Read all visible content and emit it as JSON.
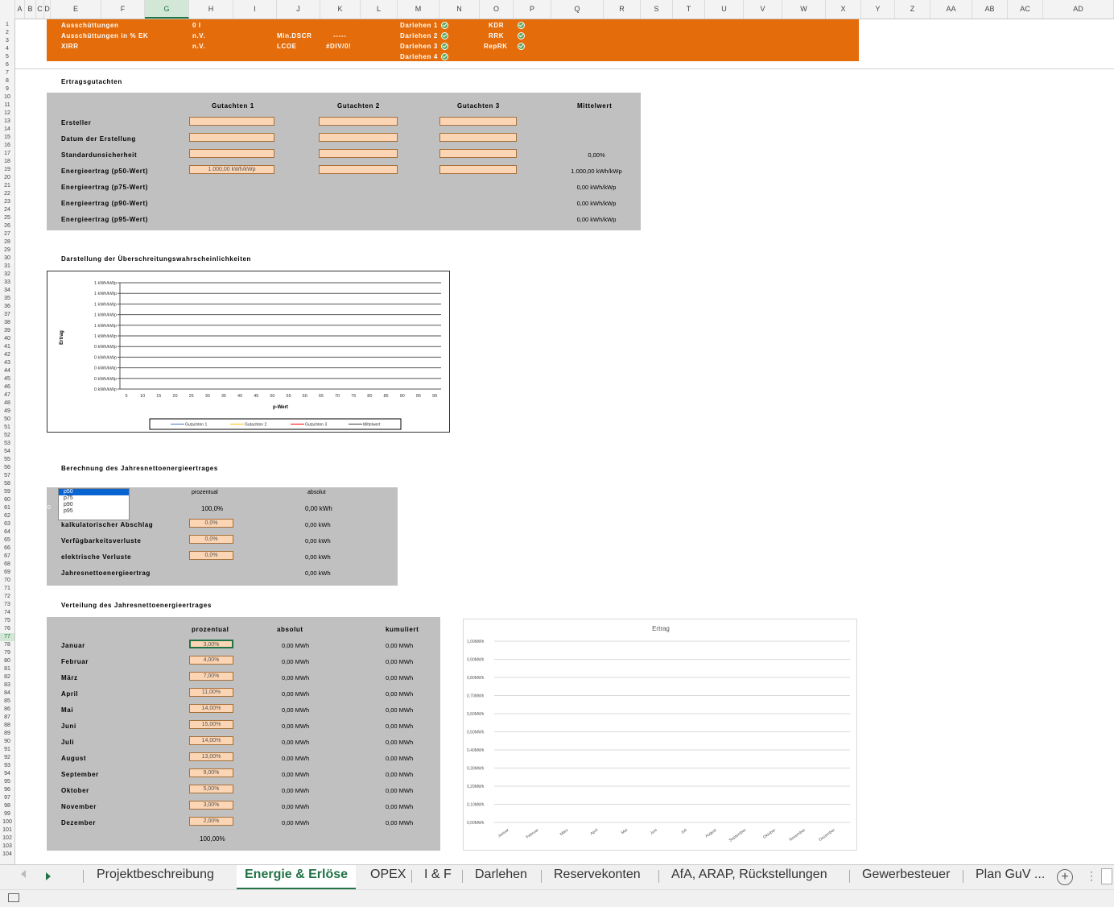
{
  "columns": [
    "A",
    "B",
    "C",
    "D",
    "E",
    "F",
    "G",
    "H",
    "I",
    "J",
    "K",
    "L",
    "M",
    "N",
    "O",
    "P",
    "Q",
    "R",
    "S",
    "T",
    "U",
    "V",
    "W",
    "X",
    "Y",
    "Z",
    "AA",
    "AB",
    "AC",
    "AD"
  ],
  "selected_column": "G",
  "selected_row": "77",
  "rows": [
    "1",
    "2",
    "3",
    "4",
    "5",
    "6",
    "7",
    "8",
    "9",
    "10",
    "11",
    "12",
    "13",
    "14",
    "15",
    "16",
    "17",
    "18",
    "19",
    "20",
    "21",
    "22",
    "23",
    "24",
    "25",
    "26",
    "27",
    "28",
    "29",
    "30",
    "31",
    "32",
    "33",
    "34",
    "35",
    "36",
    "37",
    "38",
    "39",
    "40",
    "41",
    "42",
    "43",
    "44",
    "45",
    "46",
    "47",
    "48",
    "49",
    "50",
    "51",
    "52",
    "53",
    "54",
    "55",
    "56",
    "57",
    "58",
    "59",
    "60",
    "61",
    "62",
    "63",
    "64",
    "65",
    "66",
    "67",
    "68",
    "69",
    "70",
    "71",
    "72",
    "73",
    "74",
    "75",
    "76",
    "77",
    "78",
    "79",
    "80",
    "81",
    "82",
    "83",
    "84",
    "85",
    "86",
    "87",
    "88",
    "89",
    "90",
    "91",
    "92",
    "93",
    "94",
    "95",
    "96",
    "97",
    "98",
    "99",
    "100",
    "101",
    "102",
    "103",
    "104"
  ],
  "summary": {
    "ausschuettungen_label": "Ausschüttungen",
    "ausschuettungen_value": "0 I",
    "ausschuettungen_ek_label": "Ausschüttungen in % EK",
    "ausschuettungen_ek_value": "n.V.",
    "xirr_label": "XIRR",
    "xirr_value": "n.V.",
    "min_dscr_label": "Min.DSCR",
    "min_dscr_value": "-----",
    "lcoe_label": "LCOE",
    "lcoe_value": "#DIV/0!",
    "darlehen": [
      "Darlehen 1",
      "Darlehen 2",
      "Darlehen 3",
      "Darlehen 4"
    ],
    "flags": [
      "KDR",
      "RRK",
      "RepRK"
    ]
  },
  "ertragsgutachten": {
    "title": "Ertragsgutachten",
    "headers": [
      "Gutachten 1",
      "Gutachten 2",
      "Gutachten 3",
      "Mittelwert"
    ],
    "rows": [
      {
        "label": "Ersteller",
        "g1": "",
        "mean": ""
      },
      {
        "label": "Datum der Erstellung",
        "g1": "",
        "mean": ""
      },
      {
        "label": "Standardunsicherheit",
        "g1": "",
        "mean": "0,00%"
      },
      {
        "label": "Energieertrag (p50-Wert)",
        "g1": "1.000,00 kWh/kWp",
        "mean": "1.000,00 kWh/kWp"
      },
      {
        "label": "Energieertrag (p75-Wert)",
        "g1": "",
        "mean": "0,00 kWh/kWp"
      },
      {
        "label": "Energieertrag (p90-Wert)",
        "g1": "",
        "mean": "0,00 kWh/kWp"
      },
      {
        "label": "Energieertrag (p95-Wert)",
        "g1": "",
        "mean": "0,00 kWh/kWp"
      }
    ]
  },
  "chart1": {
    "title": "Darstellung der Überschreitungswahrscheinlichkeiten",
    "ylabel": "Ertrag",
    "xlabel": "p-Wert",
    "ytick_labels": [
      "1 kWh/kWp",
      "1 kWh/kWp",
      "1 kWh/kWp",
      "1 kWh/kWp",
      "1 kWh/kWp",
      "1 kWh/kWp",
      "0 kWh/kWp",
      "0 kWh/kWp",
      "0 kWh/kWp",
      "0 kWh/kWp",
      "0 kWh/kWp"
    ],
    "legend": [
      "Gutachten 1",
      "Gutachten 2",
      "Gutachten 3",
      "Mittelwert"
    ],
    "legend_colors": [
      "#4472c4",
      "#ffc000",
      "#ff0000",
      "#404040"
    ]
  },
  "chart_data": [
    {
      "type": "line",
      "title": "",
      "xlabel": "p-Wert",
      "ylabel": "Ertrag",
      "x": [
        5,
        10,
        15,
        20,
        25,
        30,
        35,
        40,
        45,
        50,
        55,
        60,
        65,
        70,
        75,
        80,
        85,
        90,
        95,
        99
      ],
      "ylim": [
        0,
        1
      ],
      "series": [
        {
          "name": "Gutachten 1",
          "values": []
        },
        {
          "name": "Gutachten 2",
          "values": []
        },
        {
          "name": "Gutachten 3",
          "values": []
        },
        {
          "name": "Mittelwert",
          "values": []
        }
      ],
      "legend": "bottom",
      "grid": true
    },
    {
      "type": "bar",
      "title": "Ertrag",
      "categories": [
        "Januar",
        "Februar",
        "März",
        "April",
        "Mai",
        "Juni",
        "Juli",
        "August",
        "September",
        "Oktober",
        "November",
        "Dezember"
      ],
      "values": [
        0,
        0,
        0,
        0,
        0,
        0,
        0,
        0,
        0,
        0,
        0,
        0
      ],
      "ylim": [
        0,
        1
      ],
      "ytick_labels": [
        "0,00MWh",
        "0,10MWh",
        "0,20MWh",
        "0,30MWh",
        "0,40MWh",
        "0,50MWh",
        "0,60MWh",
        "0,70MWh",
        "0,80MWh",
        "0,90MWh",
        "1,00MWh"
      ],
      "grid": true
    }
  ],
  "berechnung": {
    "title": "Berechnung des Jahresnettoenergieertrages",
    "dropdown_options": [
      "p50",
      "p75",
      "p90",
      "p95"
    ],
    "dropdown_left_value": "0",
    "headers": [
      "prozentual",
      "absolut"
    ],
    "base_pct": "100,0%",
    "base_abs": "0,00 kWh",
    "rows": [
      {
        "label": "kalkulatorischer Abschlag",
        "pct": "0,0%",
        "abs": "0,00 kWh"
      },
      {
        "label": "Verfügbarkeitsverluste",
        "pct": "0,0%",
        "abs": "0,00 kWh"
      },
      {
        "label": "elektrische Verluste",
        "pct": "0,0%",
        "abs": "0,00 kWh"
      },
      {
        "label": "Jahresnettoenergieertrag",
        "pct": "",
        "abs": "0,00 kWh"
      }
    ]
  },
  "verteilung": {
    "title": "Verteilung des Jahresnettoenergieertrages",
    "headers": [
      "prozentual",
      "absolut",
      "kumuliert"
    ],
    "total": "100,00%",
    "months": [
      {
        "name": "Januar",
        "pct": "3,00%",
        "abs": "0,00 MWh",
        "cum": "0,00 MWh"
      },
      {
        "name": "Februar",
        "pct": "4,00%",
        "abs": "0,00 MWh",
        "cum": "0,00 MWh"
      },
      {
        "name": "März",
        "pct": "7,00%",
        "abs": "0,00 MWh",
        "cum": "0,00 MWh"
      },
      {
        "name": "April",
        "pct": "11,00%",
        "abs": "0,00 MWh",
        "cum": "0,00 MWh"
      },
      {
        "name": "Mai",
        "pct": "14,00%",
        "abs": "0,00 MWh",
        "cum": "0,00 MWh"
      },
      {
        "name": "Juni",
        "pct": "15,00%",
        "abs": "0,00 MWh",
        "cum": "0,00 MWh"
      },
      {
        "name": "Juli",
        "pct": "14,00%",
        "abs": "0,00 MWh",
        "cum": "0,00 MWh"
      },
      {
        "name": "August",
        "pct": "13,00%",
        "abs": "0,00 MWh",
        "cum": "0,00 MWh"
      },
      {
        "name": "September",
        "pct": "9,00%",
        "abs": "0,00 MWh",
        "cum": "0,00 MWh"
      },
      {
        "name": "Oktober",
        "pct": "5,00%",
        "abs": "0,00 MWh",
        "cum": "0,00 MWh"
      },
      {
        "name": "November",
        "pct": "3,00%",
        "abs": "0,00 MWh",
        "cum": "0,00 MWh"
      },
      {
        "name": "Dezember",
        "pct": "2,00%",
        "abs": "0,00 MWh",
        "cum": "0,00 MWh"
      }
    ]
  },
  "tabs": [
    "Projektbeschreibung",
    "Energie & Erlöse",
    "OPEX",
    "I & F",
    "Darlehen",
    "Reservekonten",
    "AfA, ARAP, Rückstellungen",
    "Gewerbesteuer",
    "Plan GuV ..."
  ],
  "active_tab": "Energie & Erlöse",
  "colors": {
    "accent": "#217346",
    "orange": "#e46c0a",
    "input": "#fcd5b4",
    "panel": "#c0c0c0"
  }
}
